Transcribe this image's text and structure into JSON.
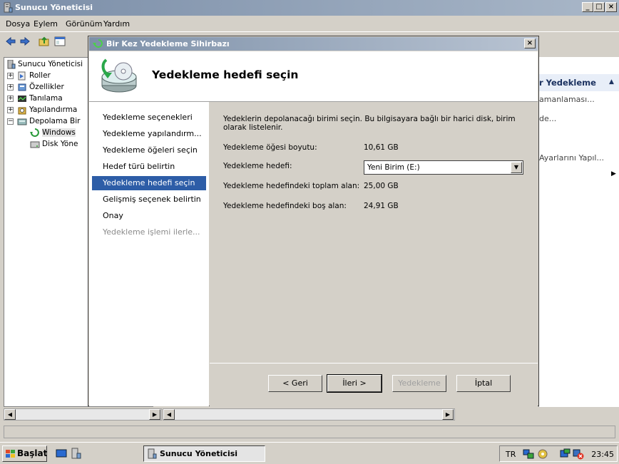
{
  "window": {
    "title": "Sunucu Yöneticisi",
    "minimize": "_",
    "maximize": "□",
    "close": "×"
  },
  "menu": {
    "items": [
      "Dosya",
      "Eylem",
      "Görünüm",
      "Yardım"
    ]
  },
  "tree": {
    "items": [
      {
        "label": "Sunucu Yöneticisi",
        "expander": ""
      },
      {
        "label": "Roller",
        "expander": "+"
      },
      {
        "label": "Özellikler",
        "expander": "+"
      },
      {
        "label": "Tanılama",
        "expander": "+"
      },
      {
        "label": "Yapılandırma",
        "expander": "+"
      },
      {
        "label": "Depolama Bir",
        "expander": "−"
      },
      {
        "label": "Windows",
        "expander": ""
      },
      {
        "label": "Disk Yöne",
        "expander": ""
      }
    ]
  },
  "actions": {
    "header": "r Yedekleme",
    "header_arrow": "▲",
    "items": [
      "amanlaması...",
      "de...",
      "Ayarlarını Yapıl...",
      "▶"
    ]
  },
  "dialog": {
    "title": "Bir Kez Yedekleme Sihirbazı",
    "close": "×",
    "heading": "Yedekleme hedefi seçin",
    "steps": [
      {
        "label": "Yedekleme seçenekleri",
        "state": "done"
      },
      {
        "label": "Yedekleme yapılandırm...",
        "state": "done"
      },
      {
        "label": "Yedekleme öğeleri seçin",
        "state": "done"
      },
      {
        "label": "Hedef türü belirtin",
        "state": "done"
      },
      {
        "label": "Yedekleme hedefi seçin",
        "state": "current"
      },
      {
        "label": "Gelişmiş seçenek belirtin",
        "state": "pending"
      },
      {
        "label": "Onay",
        "state": "pending"
      },
      {
        "label": "Yedekleme işlemi ilerle...",
        "state": "disabled"
      }
    ],
    "intro": "Yedeklerin depolanacağı birimi seçin. Bu bilgisayara bağlı bir harici disk, birim",
    "intro2": "olarak listelenir.",
    "size_label": "Yedekleme öğesi boyutu:",
    "size_value": "10,61 GB",
    "dest_label": "Yedekleme hedefi:",
    "dest_value": "Yeni Birim (E:)",
    "total_label": "Yedekleme hedefindeki toplam alan:",
    "total_value": "25,00 GB",
    "free_label": "Yedekleme hedefindeki boş alan:",
    "free_value": "24,91 GB",
    "buttons": {
      "back": "< Geri",
      "next": "İleri >",
      "backup": "Yedekleme",
      "cancel": "İptal"
    }
  },
  "taskbar": {
    "start": "Başlat",
    "task": "Sunucu Yöneticisi",
    "lang": "TR",
    "clock": "23:45"
  },
  "colors": {
    "selection": "#2d5da7",
    "titlebar": "#7b8ea8"
  }
}
